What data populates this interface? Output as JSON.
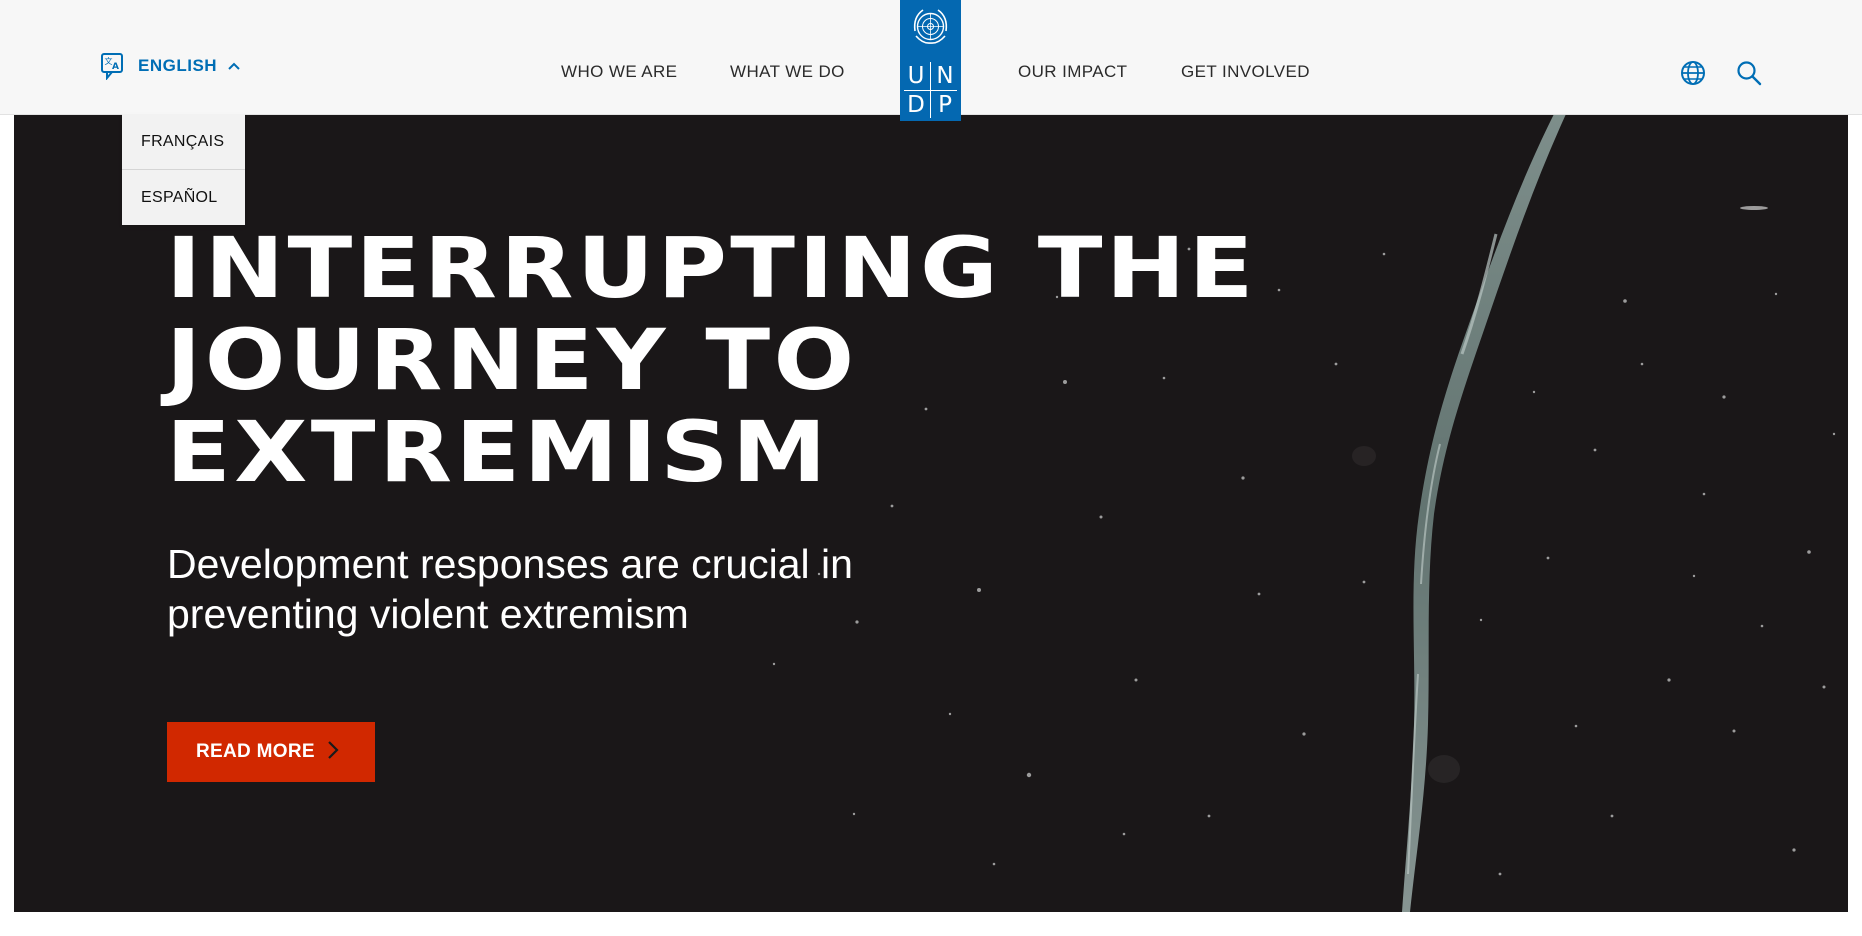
{
  "header": {
    "language": {
      "current": "ENGLISH",
      "options": [
        "FRANÇAIS",
        "ESPAÑOL"
      ],
      "icon": "translate-icon",
      "expanded_icon": "chevron-up-icon"
    },
    "nav": [
      "WHO WE ARE",
      "WHAT WE DO",
      "OUR IMPACT",
      "GET INVOLVED"
    ],
    "logo": {
      "letters": [
        "U",
        "N",
        "D",
        "P"
      ],
      "icon": "un-emblem-icon"
    },
    "tools": {
      "globe_icon": "globe-icon",
      "search_icon": "search-icon"
    }
  },
  "hero": {
    "title": "INTERRUPTING THE JOURNEY TO EXTREMISM",
    "subtitle": "Development responses are crucial in preventing violent extremism",
    "cta": "READ MORE",
    "cta_icon": "chevron-right-icon"
  },
  "colors": {
    "accent_blue": "#006eb5",
    "logo_blue": "#0468b1",
    "cta_red": "#d12800",
    "hero_bg": "#1a1718",
    "header_bg": "#f7f7f7"
  }
}
